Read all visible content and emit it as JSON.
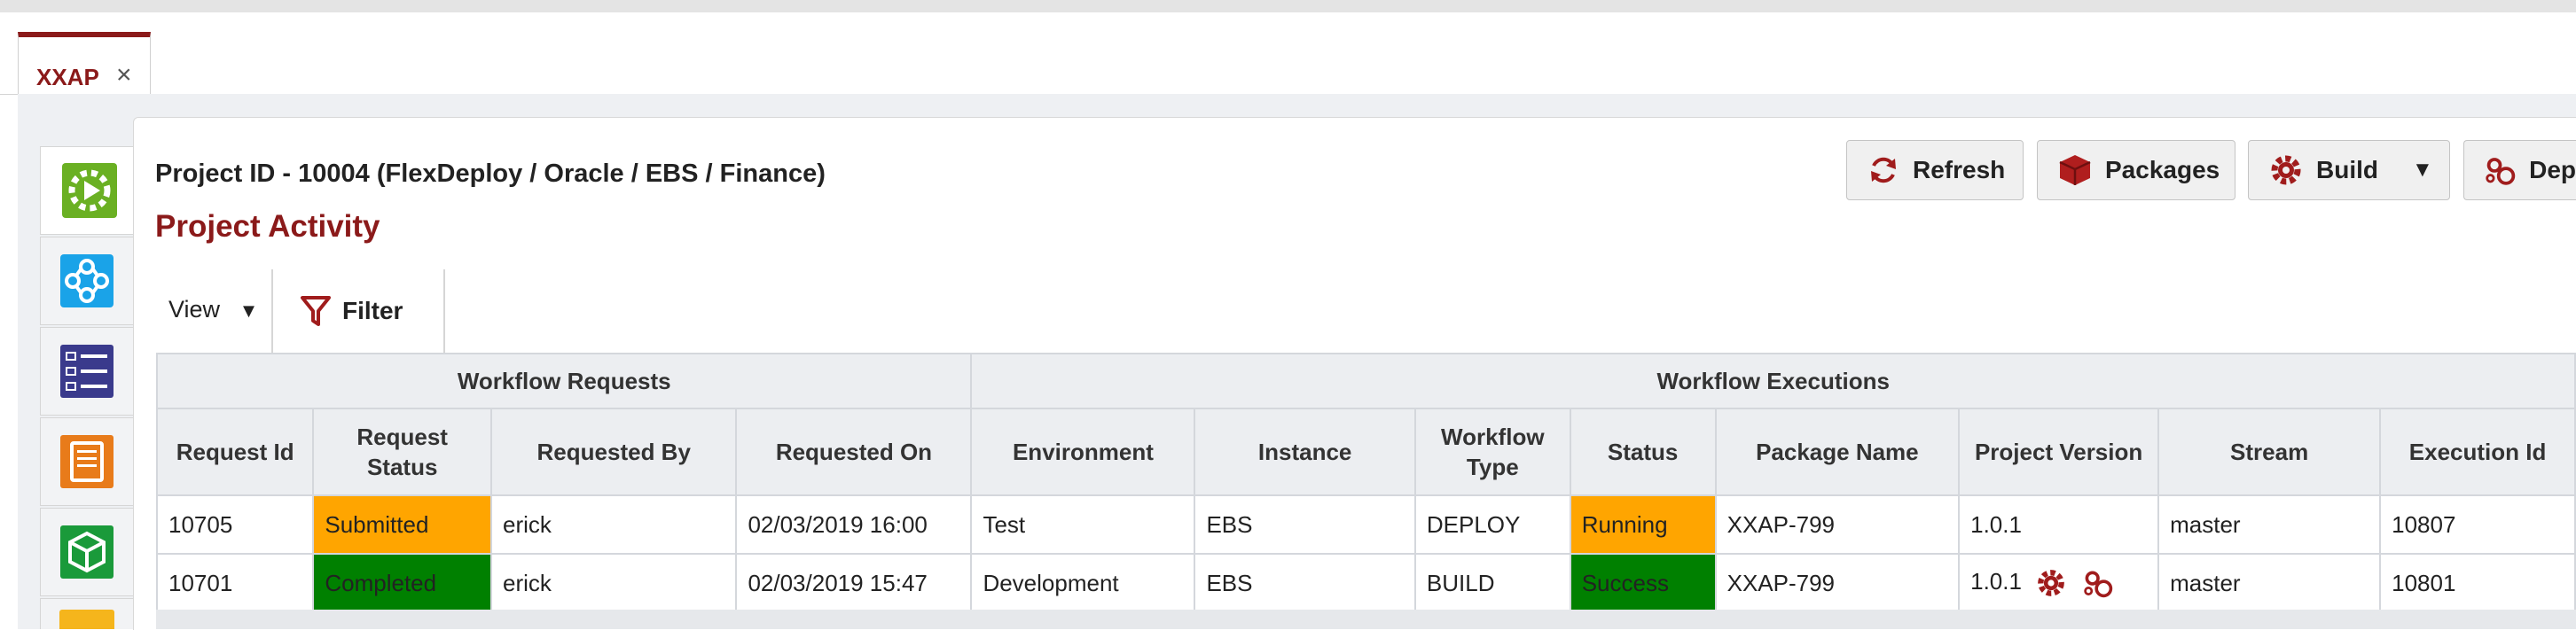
{
  "tabs": [
    {
      "label": "XXAP",
      "close": "×"
    }
  ],
  "header": {
    "breadcrumb": "Project ID - 10004 (FlexDeploy / Oracle / EBS / Finance)",
    "title": "Project Activity"
  },
  "actions": {
    "refresh": "Refresh",
    "packages": "Packages",
    "build": "Build",
    "deploy": "Dep"
  },
  "toolbar": {
    "view": "View",
    "filter": "Filter"
  },
  "sidebar": {
    "items": [
      {
        "icon": "gear-play-icon",
        "color": "#6ab023"
      },
      {
        "icon": "workflow-icon",
        "color": "#1aa3e8"
      },
      {
        "icon": "list-icon",
        "color": "#3a3a8c"
      },
      {
        "icon": "document-icon",
        "color": "#e87b1a"
      },
      {
        "icon": "package-icon",
        "color": "#1a9a3a"
      }
    ]
  },
  "table": {
    "groups": [
      "Workflow Requests",
      "Workflow Executions"
    ],
    "columns": [
      "Request Id",
      "Request Status",
      "Requested By",
      "Requested On",
      "Environment",
      "Instance",
      "Workflow Type",
      "Status",
      "Package Name",
      "Project Version",
      "Stream",
      "Execution Id"
    ],
    "rows": [
      {
        "request_id": "10705",
        "request_status": "Submitted",
        "requested_by": "erick",
        "requested_on": "02/03/2019 16:00",
        "environment": "Test",
        "instance": "EBS",
        "workflow_type": "DEPLOY",
        "status": "Running",
        "package_name": "XXAP-799",
        "project_version": "1.0.1",
        "stream": "master",
        "execution_id": "10807"
      },
      {
        "request_id": "10701",
        "request_status": "Completed",
        "requested_by": "erick",
        "requested_on": "02/03/2019 15:47",
        "environment": "Development",
        "instance": "EBS",
        "workflow_type": "BUILD",
        "status": "Success",
        "package_name": "XXAP-799",
        "project_version": "1.0.1",
        "stream": "master",
        "execution_id": "10801"
      }
    ]
  },
  "colors": {
    "accent": "#8b1a1a",
    "submitted": "#ffa500",
    "completed": "#008000"
  }
}
